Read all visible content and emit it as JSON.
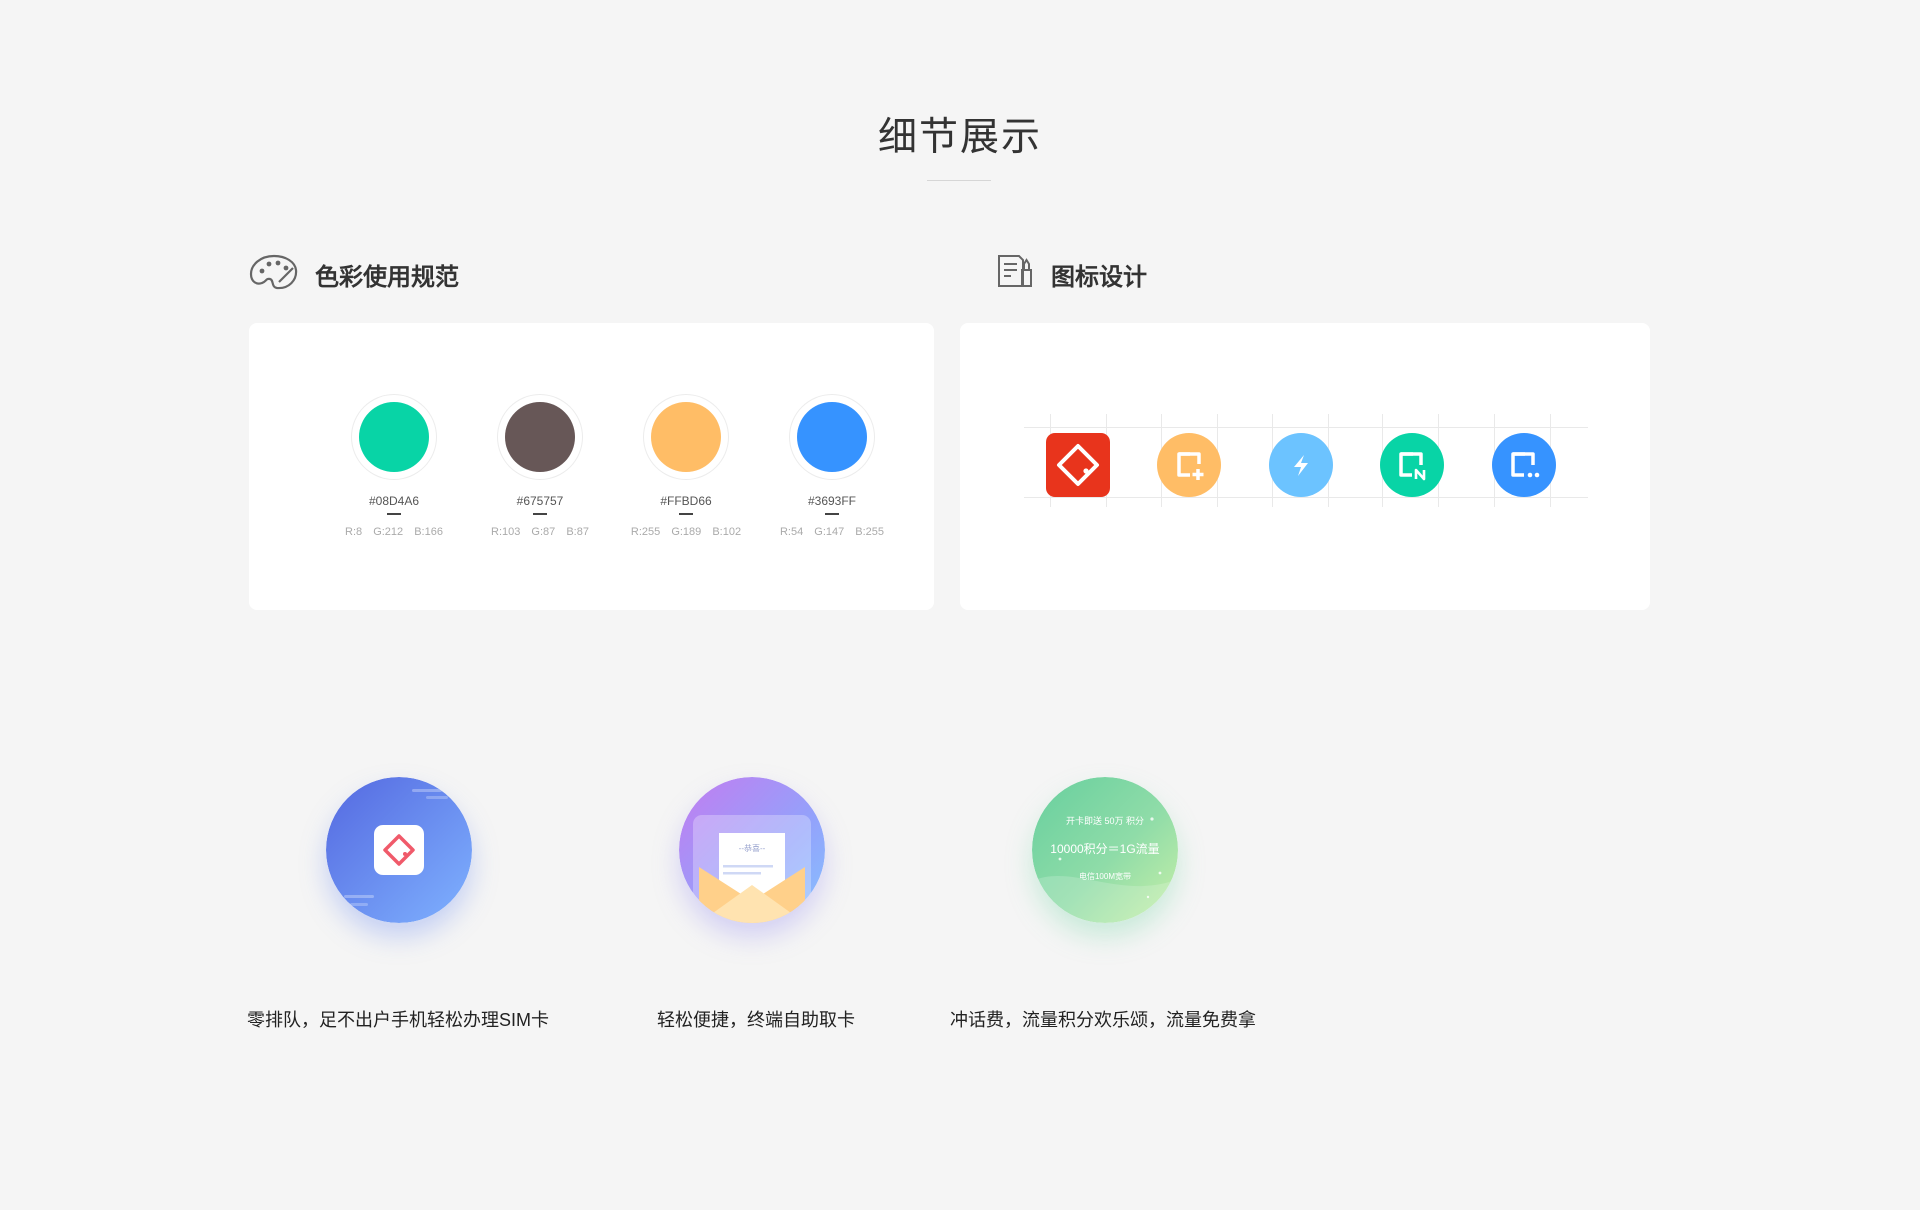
{
  "title": "细节展示",
  "color_section": {
    "label": "色彩使用规范",
    "swatches": [
      {
        "hex": "#08D4A6",
        "rgb": "R:8   G:212   B:166",
        "color": "#08D4A6"
      },
      {
        "hex": "#675757",
        "rgb": "R:103   G:87   B:87",
        "color": "#675757"
      },
      {
        "hex": "#FFBD66",
        "rgb": "R:255  G:189  B:102",
        "color": "#FFBD66"
      },
      {
        "hex": "#3693FF",
        "rgb": "R:54   G:147   B:255",
        "color": "#3693FF"
      }
    ]
  },
  "icon_section": {
    "label": "图标设计",
    "icons": [
      {
        "name": "sim-diamond-icon",
        "color": "#E8341C"
      },
      {
        "name": "card-add-icon",
        "color": "#FFBD66"
      },
      {
        "name": "lightning-icon",
        "color": "#6CC3FF"
      },
      {
        "name": "card-n-icon",
        "color": "#08D4A6"
      },
      {
        "name": "card-more-icon",
        "color": "#3693FF"
      }
    ]
  },
  "features": [
    {
      "caption": "零排队，足不出户手机轻松办理SIM卡"
    },
    {
      "caption": "轻松便捷，终端自助取卡",
      "letter_title": "--恭喜--"
    },
    {
      "caption": "冲话费，流量积分欢乐颂，流量免费拿",
      "line1": "开卡即送 50万 积分",
      "line2": "10000积分＝1G流量",
      "line3": "电信100M宽带"
    }
  ]
}
